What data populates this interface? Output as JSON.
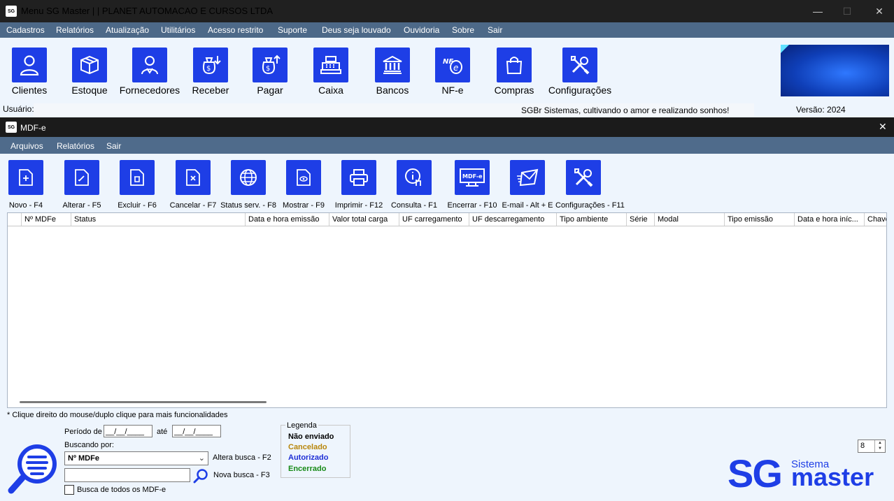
{
  "main_window": {
    "logo": "SG",
    "title": "Menu SG Master | | PLANET AUTOMACAO E CURSOS LTDA",
    "controls": {
      "minimize": "—",
      "maximize": "☐",
      "close": "✕"
    }
  },
  "main_menu": [
    "Cadastros",
    "Relatórios",
    "Atualização",
    "Utilitários",
    "Acesso restrito",
    "Suporte",
    "Deus seja louvado",
    "Ouvidoria",
    "Sobre",
    "Sair"
  ],
  "main_toolbar": [
    {
      "label": "Clientes",
      "icon": "user-icon"
    },
    {
      "label": "Estoque",
      "icon": "box-icon"
    },
    {
      "label": "Fornecedores",
      "icon": "supplier-icon"
    },
    {
      "label": "Receber",
      "icon": "money-bag-in-icon"
    },
    {
      "label": "Pagar",
      "icon": "money-bag-out-icon"
    },
    {
      "label": "Caixa",
      "icon": "cash-register-icon"
    },
    {
      "label": "Bancos",
      "icon": "bank-icon"
    },
    {
      "label": "NF-e",
      "icon": "nfe-icon"
    },
    {
      "label": "Compras",
      "icon": "shopping-bag-icon"
    },
    {
      "label": "Configurações",
      "icon": "tools-icon"
    }
  ],
  "status": {
    "user_label": "Usuário:",
    "message": "SGBr Sistemas, cultivando o amor e realizando sonhos!",
    "version": "Versão: 2024"
  },
  "mdfe_window": {
    "logo": "SG",
    "title": "MDF-e",
    "close": "✕",
    "menu": [
      "Arquivos",
      "Relatórios",
      "Sair"
    ],
    "toolbar": [
      {
        "label": "Novo - F4",
        "icon": "new-document-icon"
      },
      {
        "label": "Alterar - F5",
        "icon": "edit-document-icon"
      },
      {
        "label": "Excluir - F6",
        "icon": "delete-document-icon"
      },
      {
        "label": "Cancelar - F7",
        "icon": "cancel-document-icon"
      },
      {
        "label": "Status serv. - F8",
        "icon": "globe-status-icon"
      },
      {
        "label": "Mostrar - F9",
        "icon": "view-document-icon"
      },
      {
        "label": "Imprimir - F12",
        "icon": "printer-icon"
      },
      {
        "label": "Consulta - F1",
        "icon": "info-click-icon"
      },
      {
        "label": "Encerrar - F10",
        "icon": "mdfe-monitor-icon"
      },
      {
        "label": "E-mail - Alt + E",
        "icon": "email-icon"
      },
      {
        "label": "Configurações - F11",
        "icon": "tools-icon"
      }
    ],
    "monitor_text": "MDF-e",
    "grid_columns": [
      "Nº MDFe",
      "Status",
      "Data e hora emissão",
      "Valor total carga",
      "UF carregamento",
      "UF descarregamento",
      "Tipo ambiente",
      "Série",
      "Modal",
      "Tipo emissão",
      "Data e hora iníc...",
      "Chave"
    ],
    "hint": "* Clique direito do mouse/duplo clique para mais funcionalidades",
    "filter": {
      "period_label": "Período de",
      "date_from": "__/__/____",
      "until_label": "até",
      "date_to": "__/__/____",
      "search_by_label": "Buscando por:",
      "search_by_value": "Nº MDFe",
      "change_search": "Altera busca - F2",
      "search_text": "",
      "new_search": "Nova busca - F3",
      "search_all_label": "Busca de todos os MDF-e",
      "search_all_checked": false
    },
    "legend": {
      "title": "Legenda",
      "items": [
        {
          "label": "Não enviado",
          "color": "#000000"
        },
        {
          "label": "Cancelado",
          "color": "#b8860b"
        },
        {
          "label": "Autorizado",
          "color": "#1e2fd6"
        },
        {
          "label": "Encerrado",
          "color": "#178a17"
        }
      ]
    },
    "font_size_value": "8",
    "brand": {
      "sg": "SG",
      "sistema": "Sistema",
      "master": "master",
      "color": "#1e3ee6"
    }
  }
}
